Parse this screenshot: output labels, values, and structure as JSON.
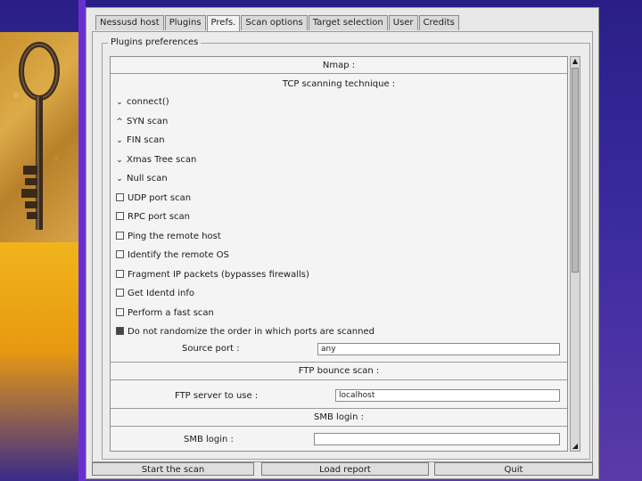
{
  "tabs": [
    {
      "label": "Nessusd host",
      "active": false
    },
    {
      "label": "Plugins",
      "active": false
    },
    {
      "label": "Prefs.",
      "active": true
    },
    {
      "label": "Scan options",
      "active": false
    },
    {
      "label": "Target selection",
      "active": false
    },
    {
      "label": "User",
      "active": false
    },
    {
      "label": "Credits",
      "active": false
    }
  ],
  "prefs": {
    "legend": "Plugins preferences",
    "nmap_header": "Nmap :",
    "tcp_header": "TCP scanning technique :",
    "techniques": [
      {
        "label": "connect()",
        "selected": true
      },
      {
        "label": "SYN scan",
        "selected": false
      },
      {
        "label": "FIN scan",
        "selected": true
      },
      {
        "label": "Xmas Tree scan",
        "selected": true
      },
      {
        "label": "Null scan",
        "selected": true
      }
    ],
    "options": [
      {
        "label": "UDP port scan",
        "checked": false
      },
      {
        "label": "RPC port scan",
        "checked": false
      },
      {
        "label": "Ping the remote host",
        "checked": false
      },
      {
        "label": "Identify the remote OS",
        "checked": false
      },
      {
        "label": "Fragment IP packets (bypasses firewalls)",
        "checked": false
      },
      {
        "label": "Get Identd info",
        "checked": false
      },
      {
        "label": "Perform a fast scan",
        "checked": false
      },
      {
        "label": "Do not randomize the order in which ports are scanned",
        "checked": true
      }
    ],
    "source_port": {
      "label": "Source port :",
      "value": "any"
    },
    "ftp_header": "FTP bounce scan :",
    "ftp_server": {
      "label": "FTP server to use :",
      "value": "localhost"
    },
    "smb_header": "SMB login :",
    "smb_login": {
      "label": "SMB login :",
      "value": ""
    }
  },
  "buttons": {
    "start": "Start the scan",
    "load": "Load report",
    "quit": "Quit"
  },
  "scrollbar": {
    "up_arrow": "▲",
    "grip": "◢"
  },
  "colors": {
    "slide_background": "#2a1e86",
    "accent_purple": "#6a2fd0",
    "gold": "#f0b41c",
    "window_gray": "#e8e8e8"
  },
  "icons": {
    "key_photo": "antique-key-photo"
  }
}
